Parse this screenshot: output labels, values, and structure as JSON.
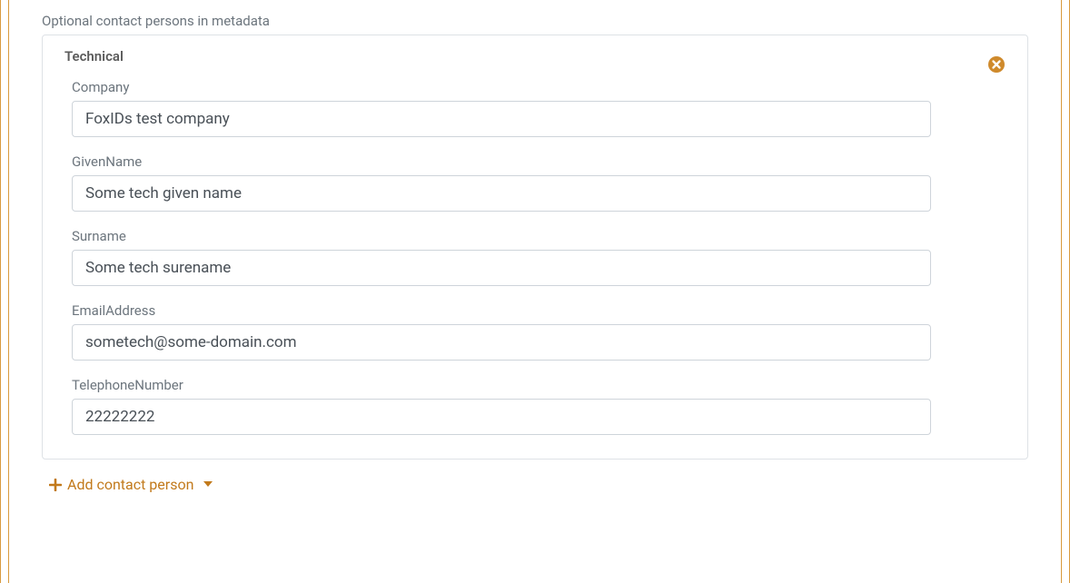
{
  "section": {
    "title": "Optional contact persons in metadata"
  },
  "contact": {
    "type_label": "Technical",
    "company_label": "Company",
    "company_value": "FoxIDs test company",
    "givenname_label": "GivenName",
    "givenname_value": "Some tech given name",
    "surname_label": "Surname",
    "surname_value": "Some tech surename",
    "email_label": "EmailAddress",
    "email_value": "sometech@some-domain.com",
    "phone_label": "TelephoneNumber",
    "phone_value": "22222222"
  },
  "actions": {
    "add_contact": "Add contact person"
  },
  "colors": {
    "accent": "#c27a1c"
  }
}
